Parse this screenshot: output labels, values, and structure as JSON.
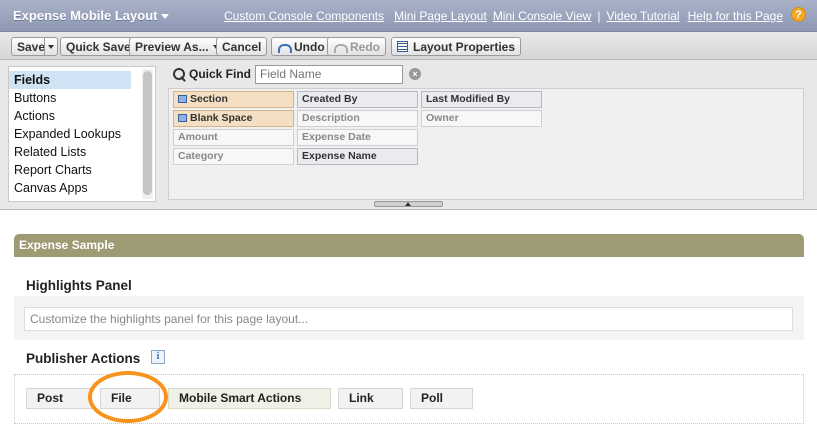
{
  "header": {
    "title": "Expense Mobile Layout",
    "links": [
      "Custom Console Components",
      "Mini Page Layout",
      "Mini Console View"
    ],
    "separator": "|",
    "video_tutorial": "Video Tutorial",
    "help": "Help for this Page",
    "help_icon": "?"
  },
  "toolbar": {
    "save": "Save",
    "quick_save": "Quick Save",
    "preview_as": "Preview As...",
    "cancel": "Cancel",
    "undo": "Undo",
    "redo": "Redo",
    "layout_properties": "Layout Properties"
  },
  "palette": {
    "categories": [
      "Fields",
      "Buttons",
      "Actions",
      "Expanded Lookups",
      "Related Lists",
      "Report Charts",
      "Canvas Apps"
    ],
    "quick_find_label": "Quick Find",
    "quick_find_placeholder": "Field Name",
    "clear_icon": "×",
    "fields": {
      "section": "Section",
      "blank_space": "Blank Space",
      "amount": "Amount",
      "category": "Category",
      "created_by": "Created By",
      "description": "Description",
      "expense_date": "Expense Date",
      "expense_name": "Expense Name",
      "last_modified_by": "Last Modified By",
      "owner": "Owner"
    }
  },
  "layout": {
    "section_title": "Expense Sample",
    "highlights_title": "Highlights Panel",
    "highlights_placeholder": "Customize the highlights panel for this page layout...",
    "publisher_title": "Publisher Actions",
    "info_icon": "i",
    "actions": [
      "Post",
      "File",
      "Mobile Smart Actions",
      "Link",
      "Poll"
    ]
  },
  "colors": {
    "header_blue": "#8e98b4",
    "section_olive": "#9e9a73",
    "highlight_orange": "#f7941e",
    "help_orange": "#f4a823"
  }
}
